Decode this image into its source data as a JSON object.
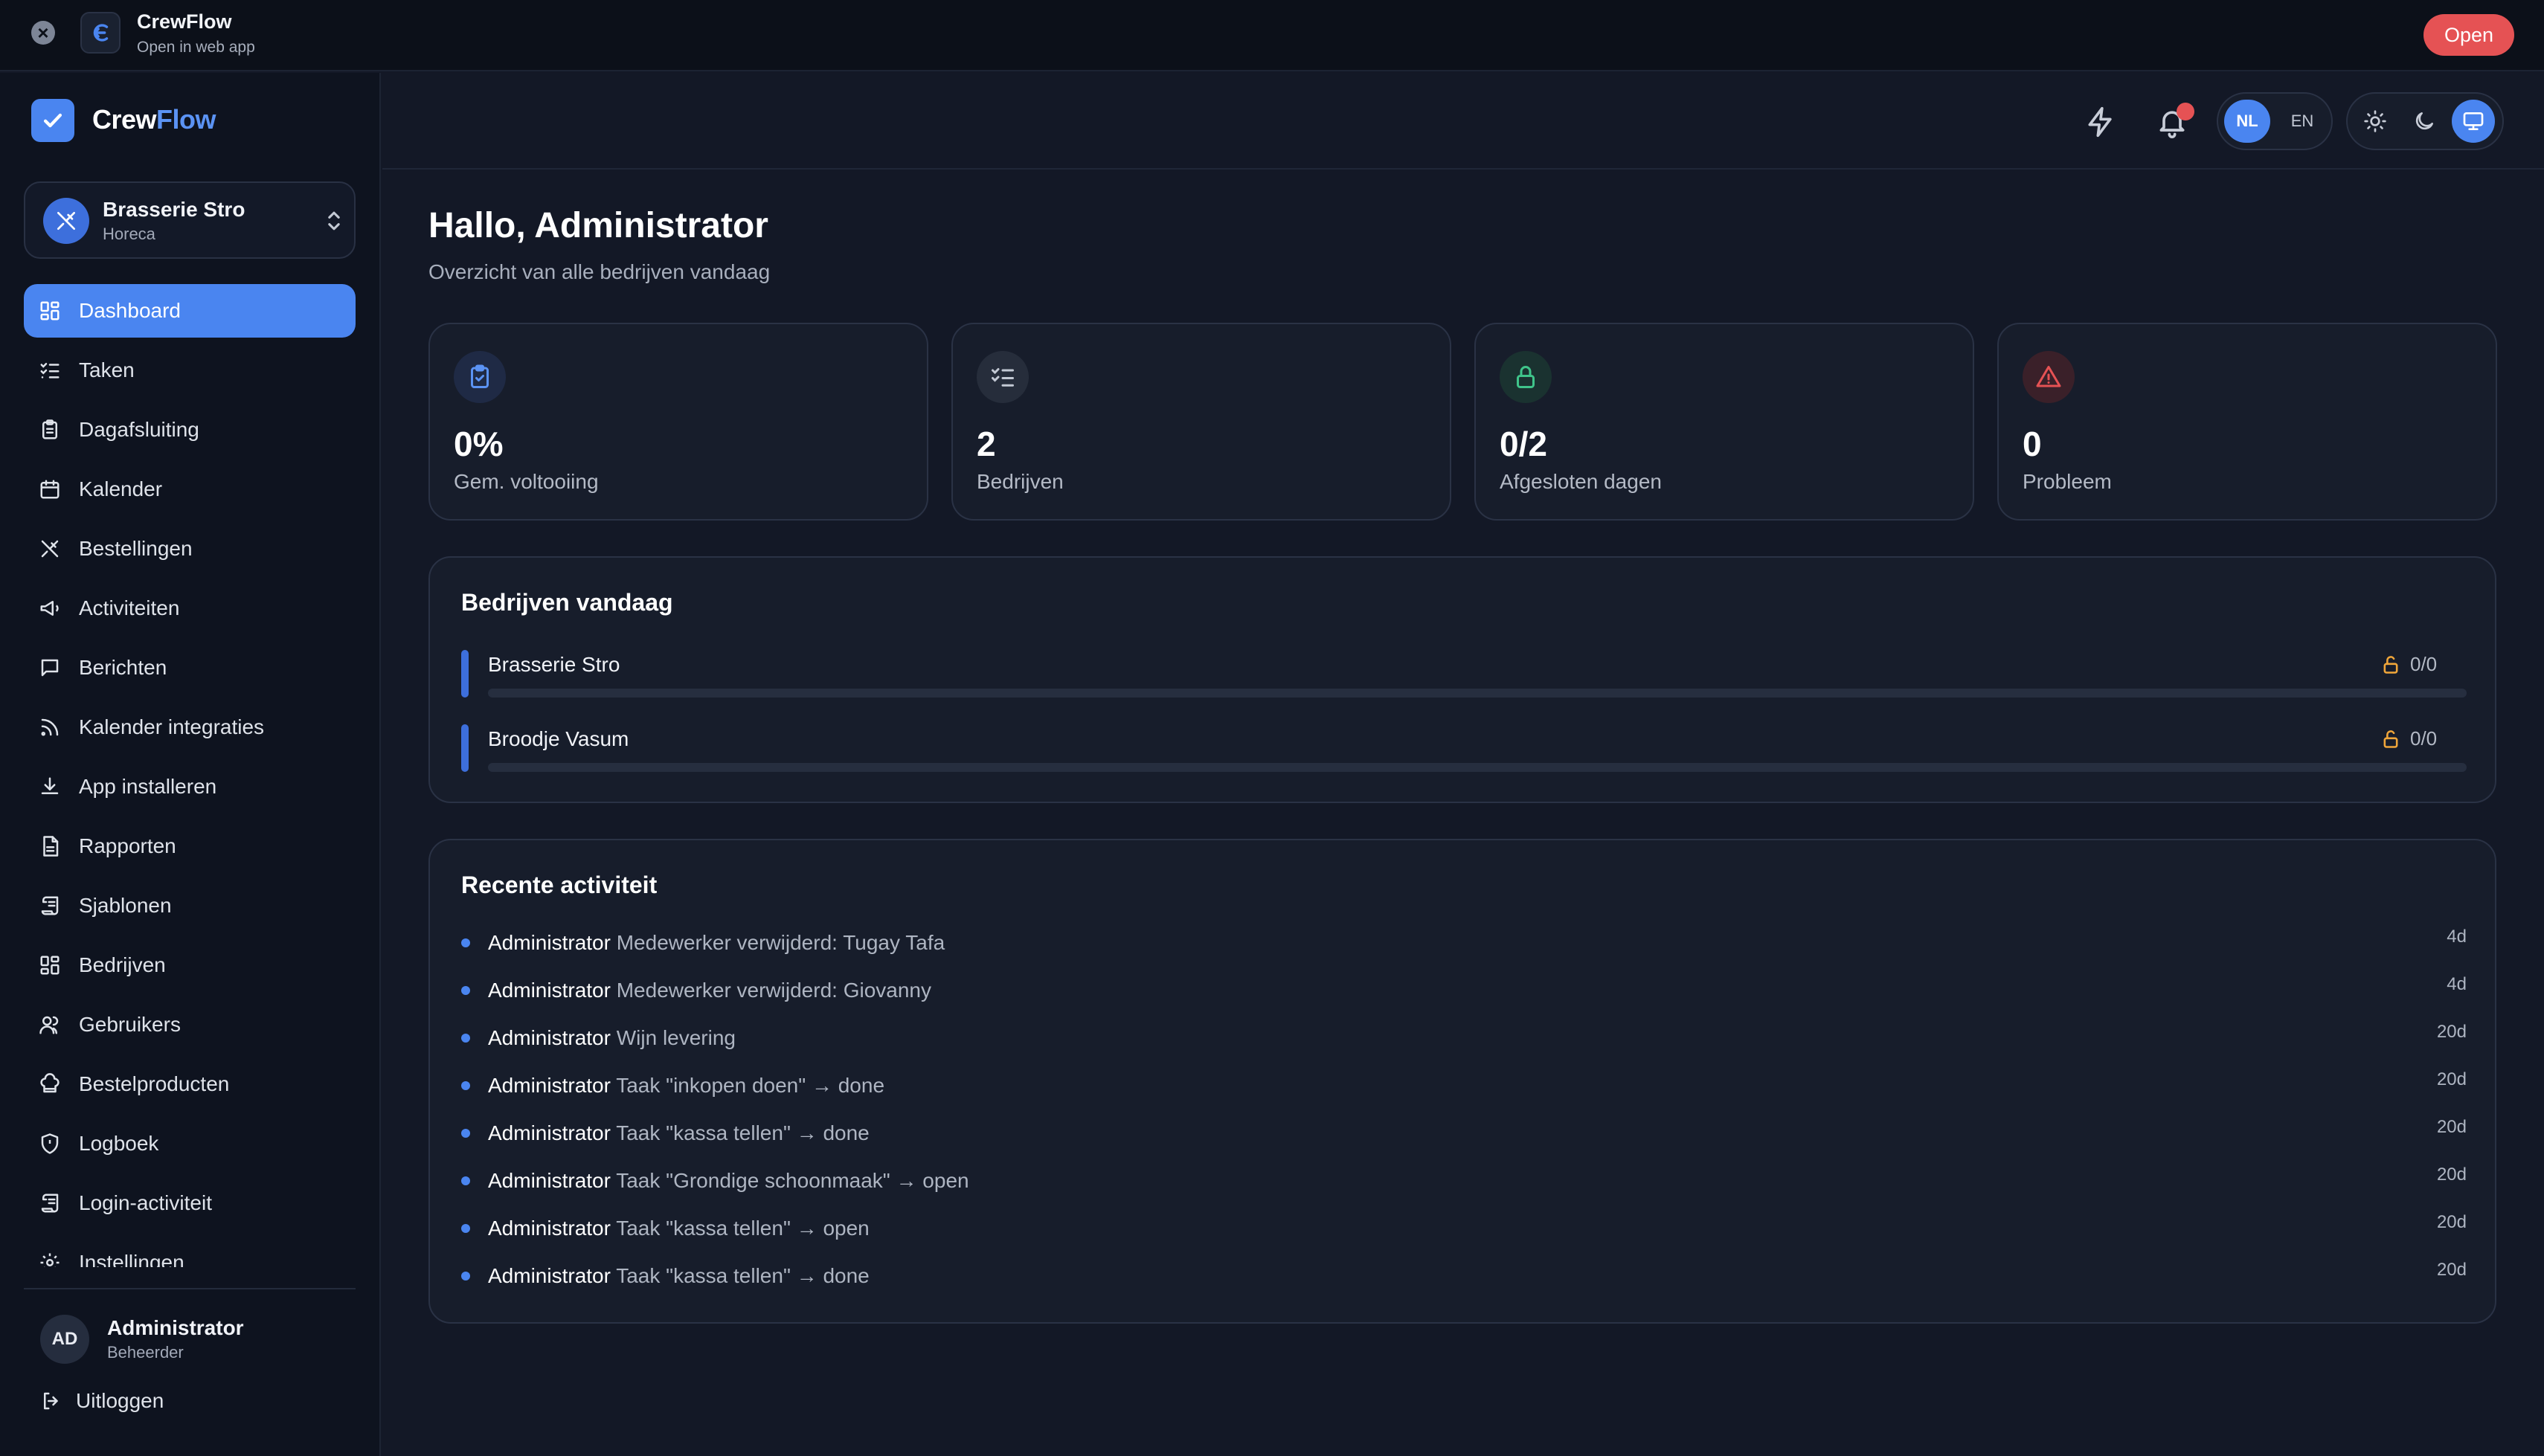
{
  "banner": {
    "title": "CrewFlow",
    "subtitle": "Open in web app",
    "open_label": "Open"
  },
  "brand": {
    "part1": "Crew",
    "part2": "Flow"
  },
  "business_switcher": {
    "name": "Brasserie Stro",
    "category": "Horeca"
  },
  "nav": {
    "items": [
      {
        "label": "Dashboard",
        "icon": "grid-icon",
        "active": true
      },
      {
        "label": "Taken",
        "icon": "checklist-icon"
      },
      {
        "label": "Dagafsluiting",
        "icon": "clipboard-icon"
      },
      {
        "label": "Kalender",
        "icon": "calendar-icon"
      },
      {
        "label": "Bestellingen",
        "icon": "utensils-icon"
      },
      {
        "label": "Activiteiten",
        "icon": "megaphone-icon"
      },
      {
        "label": "Berichten",
        "icon": "message-icon"
      },
      {
        "label": "Kalender integraties",
        "icon": "rss-icon"
      },
      {
        "label": "App installeren",
        "icon": "download-icon"
      },
      {
        "label": "Rapporten",
        "icon": "report-icon"
      },
      {
        "label": "Sjablonen",
        "icon": "scroll-icon"
      },
      {
        "label": "Bedrijven",
        "icon": "grid-icon"
      },
      {
        "label": "Gebruikers",
        "icon": "users-icon"
      },
      {
        "label": "Bestelproducten",
        "icon": "chef-hat-icon"
      },
      {
        "label": "Logboek",
        "icon": "shield-icon"
      },
      {
        "label": "Login-activiteit",
        "icon": "scroll-icon"
      },
      {
        "label": "Instellingen",
        "icon": "gear-icon"
      }
    ]
  },
  "user": {
    "initials": "AD",
    "name": "Administrator",
    "role": "Beheerder",
    "logout_label": "Uitloggen"
  },
  "header": {
    "lang_active": "NL",
    "lang_other": "EN"
  },
  "main": {
    "greeting": "Hallo, Administrator",
    "subtitle": "Overzicht van alle bedrijven vandaag",
    "stats": [
      {
        "value": "0%",
        "label": "Gem. voltooiing",
        "icon": "clipboard-check-icon",
        "color": "#5b93f4"
      },
      {
        "value": "2",
        "label": "Bedrijven",
        "icon": "checklist-icon",
        "color": "#c3c9d4"
      },
      {
        "value": "0/2",
        "label": "Afgesloten dagen",
        "icon": "lock-icon",
        "color": "#3fc48a"
      },
      {
        "value": "0",
        "label": "Probleem",
        "icon": "alert-triangle-icon",
        "color": "#e55254"
      }
    ],
    "businesses": {
      "title": "Bedrijven vandaag",
      "items": [
        {
          "name": "Brasserie Stro",
          "count": "0/0",
          "progress": 0
        },
        {
          "name": "Broodje Vasum",
          "count": "0/0",
          "progress": 0
        }
      ]
    },
    "activity": {
      "title": "Recente activiteit",
      "items": [
        {
          "user": "Administrator",
          "text": "Medewerker verwijderd: Tugay Tafa",
          "time": "4d"
        },
        {
          "user": "Administrator",
          "text": "Medewerker verwijderd: Giovanny",
          "time": "4d"
        },
        {
          "user": "Administrator",
          "text": "Wijn levering",
          "time": "20d"
        },
        {
          "user": "Administrator",
          "text": "Taak \"inkopen doen\" → done",
          "time": "20d"
        },
        {
          "user": "Administrator",
          "text": "Taak \"kassa tellen\" → done",
          "time": "20d"
        },
        {
          "user": "Administrator",
          "text": "Taak \"Grondige schoonmaak\" → open",
          "time": "20d"
        },
        {
          "user": "Administrator",
          "text": "Taak \"kassa tellen\" → open",
          "time": "20d"
        },
        {
          "user": "Administrator",
          "text": "Taak \"kassa tellen\" → done",
          "time": "20d"
        }
      ]
    }
  },
  "colors": {
    "accent": "#4a85f0",
    "background": "#131826",
    "sidebar": "#0e131f",
    "card": "#171d2b",
    "danger": "#e55254",
    "warning": "#f0a63a"
  }
}
